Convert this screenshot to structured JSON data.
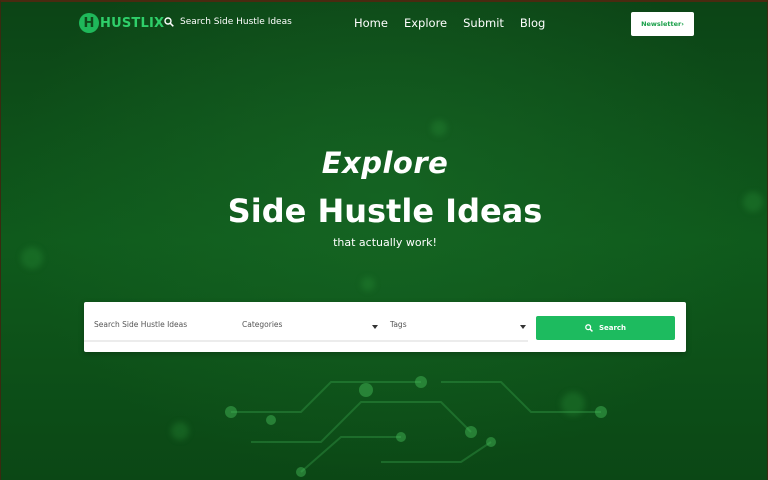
{
  "brand": {
    "logo_letter": "H",
    "logo_text": "HUSTLIX",
    "accent_color": "#1fb85a",
    "background_color": "#0f4a1a"
  },
  "nav": {
    "search_text": "Search Side Hustle Ideas",
    "search_icon": "search-icon",
    "menu": [
      {
        "label": "Home"
      },
      {
        "label": "Explore"
      },
      {
        "label": "Submit"
      },
      {
        "label": "Blog"
      }
    ],
    "newsletter_label": "Newsletter›"
  },
  "hero": {
    "kicker": "Explore",
    "title": "Side Hustle Ideas",
    "subtitle": "that actually work!"
  },
  "search_panel": {
    "keyword_placeholder": "Search Side Hustle Ideas",
    "categories_label": "Categories",
    "tags_label": "Tags",
    "search_button_label": "Search",
    "button_color": "#1dbb5f"
  }
}
